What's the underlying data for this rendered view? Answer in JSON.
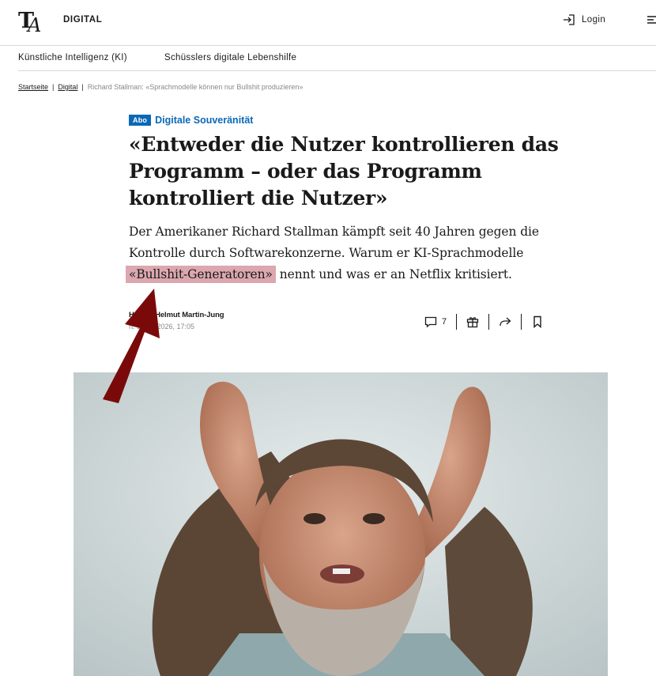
{
  "header": {
    "section": "DIGITAL",
    "login_label": "Login"
  },
  "subnav": {
    "items": [
      "Künstliche Intelligenz (KI)",
      "Schüsslers digitale Lebenshilfe"
    ]
  },
  "breadcrumb": {
    "home": "Startseite",
    "section": "Digital",
    "current": "Richard Stallman: «Sprachmodelle können nur Bullshit produzieren»"
  },
  "article": {
    "badge": "Abo",
    "topic": "Digitale Souveränität",
    "headline": "«Entweder die Nutzer kontrollieren das Programm – oder das Programm kontrolliert die Nutzer»",
    "lead_line1": "Der Amerikaner Richard Stallman kämpft seit 40 Jahren gegen die",
    "lead_line2": "Kontrolle durch Softwarekonzerne. Warum er KI-Sprachmodelle",
    "lead_highlight": "«Bullshit-Generatoren»",
    "lead_rest": " nennt und was er an Netflix kritisiert.",
    "authors_a": "Hauck",
    "authors_sep": ", ",
    "authors_b": "Helmut Martin-Jung",
    "date": "rt: 29.01.2026, 17:05",
    "comment_count": "7"
  },
  "icons": {
    "login": "login-icon",
    "menu": "menu-icon",
    "comment": "comment-icon",
    "gift": "gift-icon",
    "share": "share-icon",
    "bookmark": "bookmark-icon"
  },
  "colors": {
    "accent": "#0b68b6",
    "highlight": "#d4949c",
    "arrow": "#7a0a0a"
  }
}
